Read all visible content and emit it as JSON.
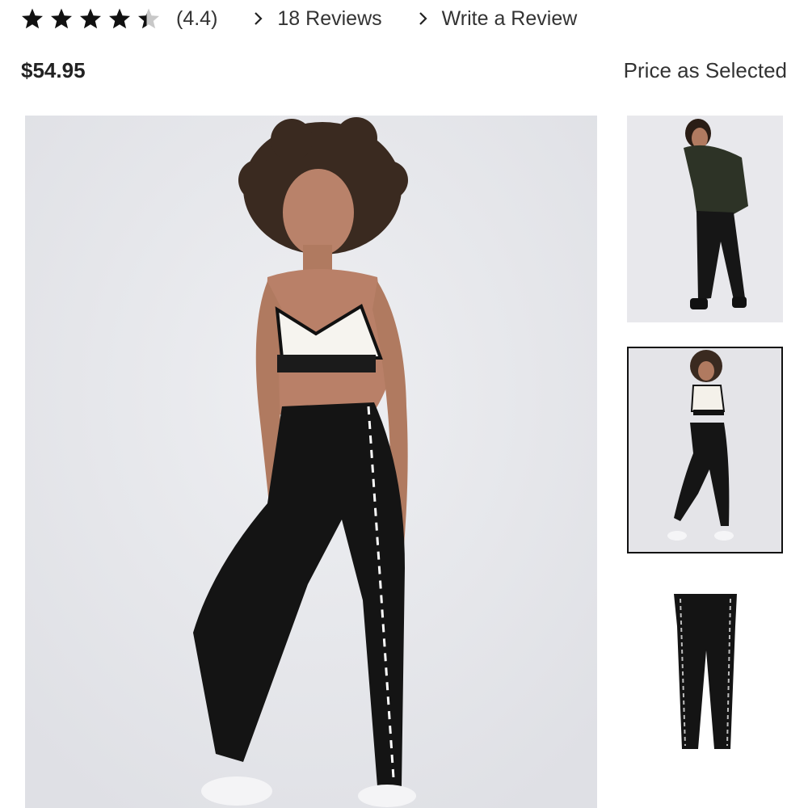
{
  "rating": {
    "stars_filled": 4.4,
    "stars_total": 5,
    "value_text": "(4.4)",
    "star_color": "#111111",
    "star_empty_color": "#c8c8c8"
  },
  "links": {
    "reviews_label": "18 Reviews",
    "write_review_label": "Write a Review",
    "chevron_icon": "chevron-right-icon"
  },
  "product": {
    "price": "$54.95",
    "price_note": "Price as Selected"
  },
  "gallery": {
    "main_image": "model-in-sports-bra-and-striped-joggers",
    "thumbnails": [
      {
        "name": "model-in-camo-hoodie-and-joggers",
        "selected": false
      },
      {
        "name": "model-in-sports-bra-and-joggers",
        "selected": true
      },
      {
        "name": "joggers-flat-lay",
        "selected": false
      }
    ],
    "selected_border_color": "#111111"
  }
}
